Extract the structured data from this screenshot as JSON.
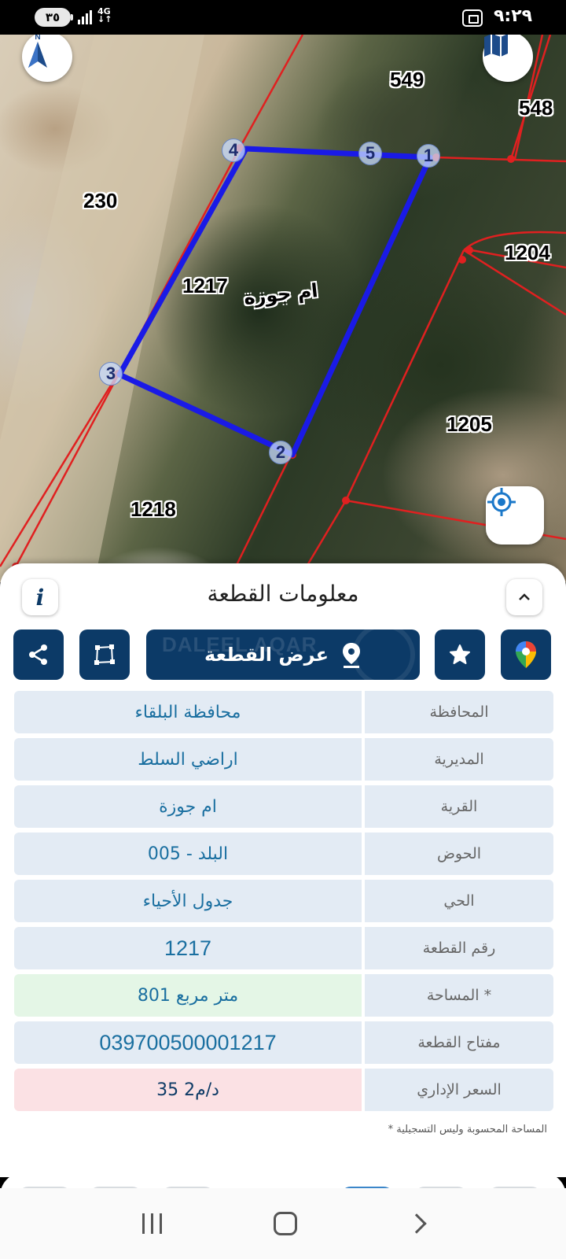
{
  "status_bar": {
    "battery": "٣٥",
    "network": "4G",
    "time": "٩:٢٩"
  },
  "map": {
    "parcel_numbers": {
      "p549": "549",
      "p548": "548",
      "p230": "230",
      "p1217": "1217",
      "p1204": "1204",
      "p1205": "1205",
      "p1218": "1218"
    },
    "village_label": "ام جوزة",
    "vertices": [
      "1",
      "2",
      "3",
      "4",
      "5"
    ],
    "compass_label": "N",
    "colors": {
      "selected_parcel": "#1a1ae6",
      "parcel_lines": "#e02020"
    }
  },
  "panel": {
    "title": "معلومات القطعة",
    "show_parcel_label": "عرض القطعة",
    "watermark": "DALEEL AQAR",
    "rows": [
      {
        "label": "المحافظة",
        "value": "محافظة البلقاء"
      },
      {
        "label": "المديرية",
        "value": "اراضي السلط"
      },
      {
        "label": "القرية",
        "value": "ام جوزة"
      },
      {
        "label": "الحوض",
        "value": "البلد - 005"
      },
      {
        "label": "الحي",
        "value": "جدول الأحياء"
      },
      {
        "label": "رقم القطعة",
        "value": "1217"
      },
      {
        "label": "المساحة *",
        "value": "801  متر مربع"
      },
      {
        "label": "مفتاح القطعة",
        "value": "039700500001217"
      },
      {
        "label": "السعر الإداري",
        "value": "35 د/م2"
      }
    ],
    "footnote": "* المساحة المحسوبة وليس التسجيلية",
    "colors": {
      "primary": "#0c3a67",
      "value_text": "#1a6fa0",
      "area_bg": "#e4f6e6",
      "price_bg": "#fbe1e4"
    }
  }
}
